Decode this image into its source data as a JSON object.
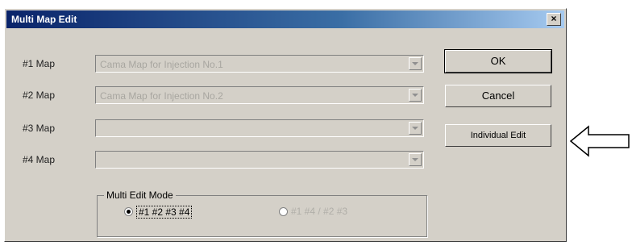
{
  "window": {
    "title": "Multi Map Edit",
    "close_label": "×"
  },
  "maps": [
    {
      "label": "#1 Map",
      "value": "Cama Map for Injection No.1"
    },
    {
      "label": "#2 Map",
      "value": "Cama Map for Injection No.2"
    },
    {
      "label": "#3 Map",
      "value": ""
    },
    {
      "label": "#4 Map",
      "value": ""
    }
  ],
  "buttons": {
    "ok": "OK",
    "cancel": "Cancel",
    "individual_edit": "Individual Edit"
  },
  "multi_edit_mode": {
    "label": "Multi Edit Mode",
    "options": [
      {
        "label": "#1 #2 #3 #4",
        "selected": true
      },
      {
        "label": "#1 #4 / #2 #3",
        "selected": false
      }
    ]
  },
  "icons": {
    "pointer_arrow": "left-arrow-icon",
    "dropdown": "chevron-down-icon"
  }
}
